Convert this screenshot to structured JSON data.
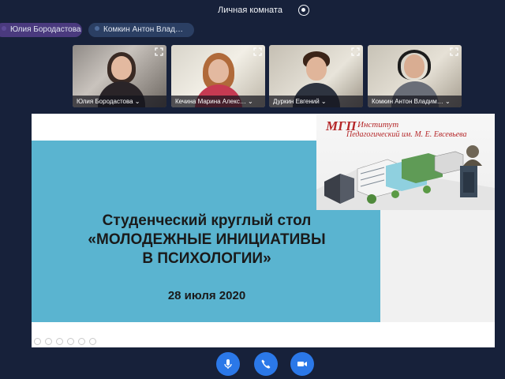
{
  "header": {
    "room_title": "Личная комната",
    "record_icon": "record-icon"
  },
  "participant_chips": [
    {
      "label": "Юлия Бородастова",
      "color": "#4a3a7e"
    },
    {
      "label": "Комкин Антон Влад…",
      "color": "#2b3f63"
    }
  ],
  "video_tiles": [
    {
      "name": "Юлия Бородастова ⌄",
      "icon": "expand-icon"
    },
    {
      "name": "Кечина Марина Алекс… ⌄",
      "icon": "expand-icon"
    },
    {
      "name": "Дуркин Евгений ⌄",
      "icon": "expand-icon"
    },
    {
      "name": "Комкин Антон Владим… ⌄",
      "icon": "expand-icon"
    }
  ],
  "slide": {
    "title_line1": "Студенческий круглый стол",
    "title_line2": "«МОЛОДЕЖНЫЕ ИНИЦИАТИВЫ",
    "title_line3": "В ПСИХОЛОГИИ»",
    "date": "28 июля 2020",
    "institute_logo": "МГП",
    "institute_line1": "Институт",
    "institute_line2": "Педагогический им. М. Е. Евсевьева",
    "accent_color": "#5ab4d0"
  },
  "controls": {
    "mic": "microphone-icon",
    "phone": "phone-icon",
    "camera": "camera-icon",
    "color": "#2b78e8"
  }
}
